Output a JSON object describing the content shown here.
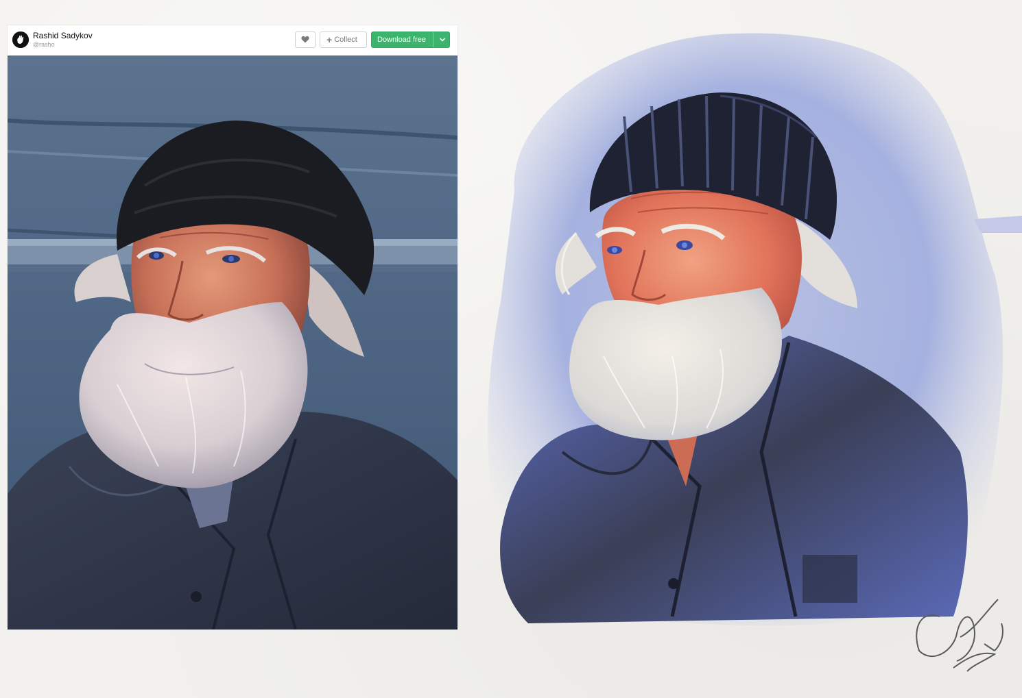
{
  "card": {
    "author": {
      "name": "Rashid Sadykov",
      "handle": "@rasho"
    },
    "actions": {
      "collect_label": "Collect",
      "download_label": "Download free"
    }
  },
  "icons": {
    "like": "heart-icon",
    "collect": "plus-icon",
    "download_menu": "chevron-down-icon",
    "avatar": "hand-icon"
  },
  "colors": {
    "download_button": "#3cb46e",
    "card_background": "#ffffff",
    "page_background": "#f2f1ee"
  }
}
